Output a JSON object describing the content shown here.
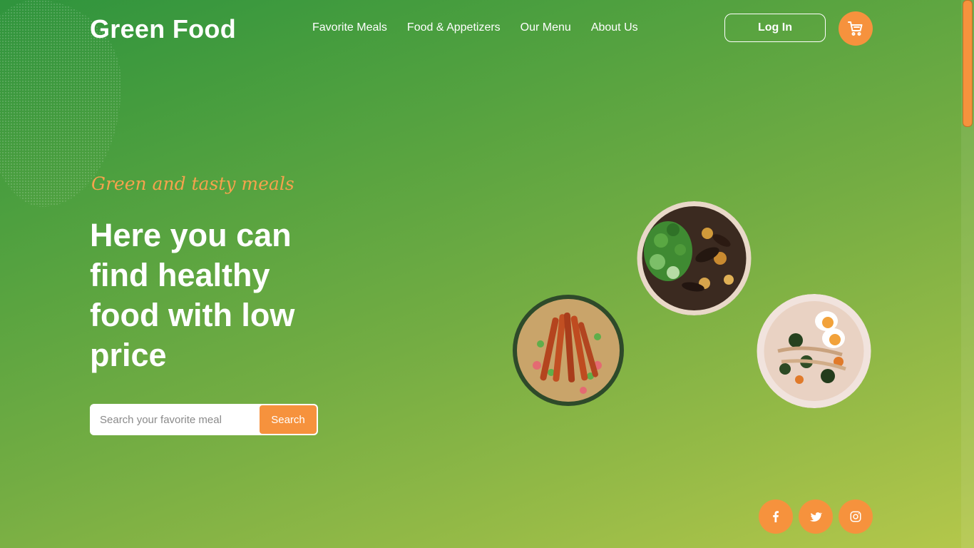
{
  "header": {
    "brand": "Green Food",
    "nav": [
      {
        "label": "Favorite Meals"
      },
      {
        "label": "Food & Appetizers"
      },
      {
        "label": "Our Menu"
      },
      {
        "label": "About Us"
      }
    ],
    "login_label": "Log In",
    "cart_icon": "cart-icon"
  },
  "hero": {
    "tagline": "Green and tasty meals",
    "headline": "Here you can find healthy food with low price"
  },
  "search": {
    "placeholder": "Search your favorite meal",
    "value": "",
    "button_label": "Search"
  },
  "social": [
    {
      "icon": "facebook-icon"
    },
    {
      "icon": "twitter-icon"
    },
    {
      "icon": "instagram-icon"
    }
  ],
  "colors": {
    "accent": "#f6923d",
    "background_start": "#2f943d",
    "background_end": "#b4c74b",
    "text": "#ffffff"
  }
}
